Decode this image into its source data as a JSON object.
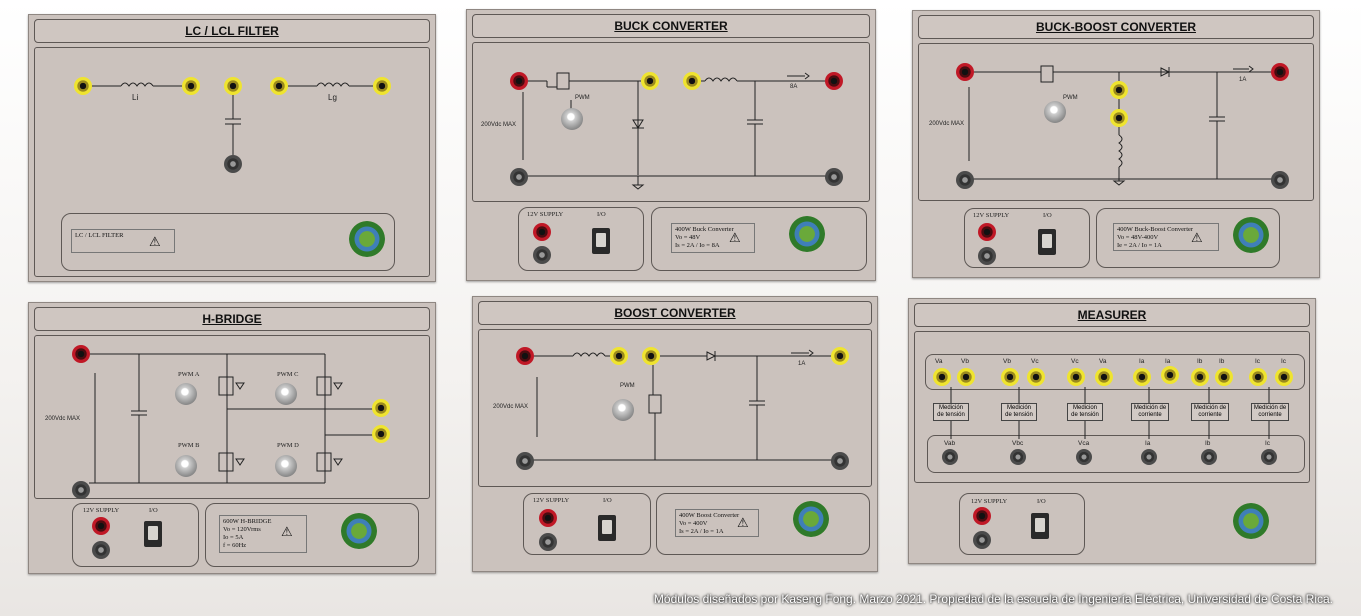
{
  "panels": {
    "lc": {
      "title": "LC / LCL FILTER",
      "li": "Li",
      "lg": "Lg",
      "plate": "LC / LCL FILTER"
    },
    "buck": {
      "title": "BUCK CONVERTER",
      "vmax": "200Vdc MAX",
      "pwm": "PWM",
      "current": "8A",
      "supply": "12V SUPPLY",
      "io": "I/O",
      "plate": [
        "400W Buck Converter",
        "Vo = 48V",
        "Is = 2A / Io = 8A"
      ]
    },
    "buckboost": {
      "title": "BUCK-BOOST CONVERTER",
      "vmax": "200Vdc MAX",
      "pwm": "PWM",
      "current": "1A",
      "supply": "12V SUPPLY",
      "io": "I/O",
      "plate": [
        "400W Buck-Boost Converter",
        "Vo = 48V-400V",
        "Ie = 2A / Io = 1A"
      ]
    },
    "hbridge": {
      "title": "H-BRIDGE",
      "vmax": "200Vdc MAX",
      "pwm": [
        "PWM A",
        "PWM C",
        "PWM B",
        "PWM D"
      ],
      "supply": "12V SUPPLY",
      "io": "I/O",
      "plate": [
        "600W H-BRIDGE",
        "Vo = 120Vrms",
        "Io = 5A",
        "f = 60Hz"
      ]
    },
    "boost": {
      "title": "BOOST CONVERTER",
      "vmax": "200Vdc MAX",
      "pwm": "PWM",
      "current": "1A",
      "supply": "12V SUPPLY",
      "io": "I/O",
      "plate": [
        "400W Boost Converter",
        "Vo = 400V",
        "Is = 2A / Io = 1A"
      ]
    },
    "measurer": {
      "title": "MEASURER",
      "supply": "12V SUPPLY",
      "io": "I/O",
      "top_labels": [
        "Va",
        "Vb",
        "Vb",
        "Vc",
        "Vc",
        "Va",
        "Ia",
        "Ia",
        "Ib",
        "Ib",
        "Ic",
        "Ic"
      ],
      "blocks": [
        [
          "Medición",
          "de tensión"
        ],
        [
          "Medición",
          "de tensión"
        ],
        [
          "Medicion",
          "de tensión"
        ],
        [
          "Medición de",
          "corriente"
        ],
        [
          "Medición de",
          "corriente"
        ],
        [
          "Medición de",
          "corriente"
        ]
      ],
      "outputs": [
        "Vab",
        "Vbc",
        "Vca",
        "Ia",
        "Ib",
        "Ic"
      ]
    }
  },
  "warning_symbol": "⚠",
  "footer": "Módulos diseñados por Kaseng Fong. Marzo 2021. Propiedad de la escuela  de Ingeniería Eléctrica, Universidad de Costa Rica."
}
